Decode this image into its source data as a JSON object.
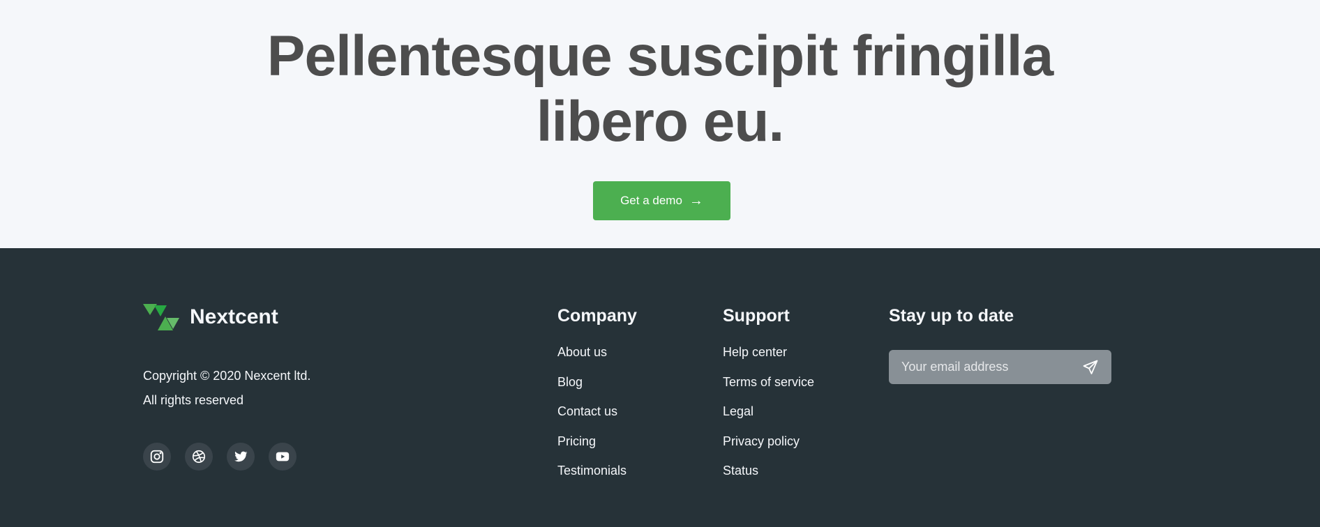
{
  "hero": {
    "title": "Pellentesque suscipit fringilla libero eu.",
    "cta_label": "Get a demo",
    "cta_arrow": "→",
    "cta_color": "#4caf50"
  },
  "footer": {
    "brand": "Nextcent",
    "copyright_line1": "Copyright © 2020 Nexcent ltd.",
    "copyright_line2": "All rights reserved",
    "socials": [
      "instagram-icon",
      "dribbble-icon",
      "twitter-icon",
      "youtube-icon"
    ],
    "company": {
      "title": "Company",
      "links": [
        "About us",
        "Blog",
        "Contact us",
        "Pricing",
        "Testimonials"
      ]
    },
    "support": {
      "title": "Support",
      "links": [
        "Help center",
        "Terms of service",
        "Legal",
        "Privacy policy",
        "Status"
      ]
    },
    "newsletter": {
      "title": "Stay up to date",
      "placeholder": "Your email address"
    },
    "background_color": "#263238"
  }
}
